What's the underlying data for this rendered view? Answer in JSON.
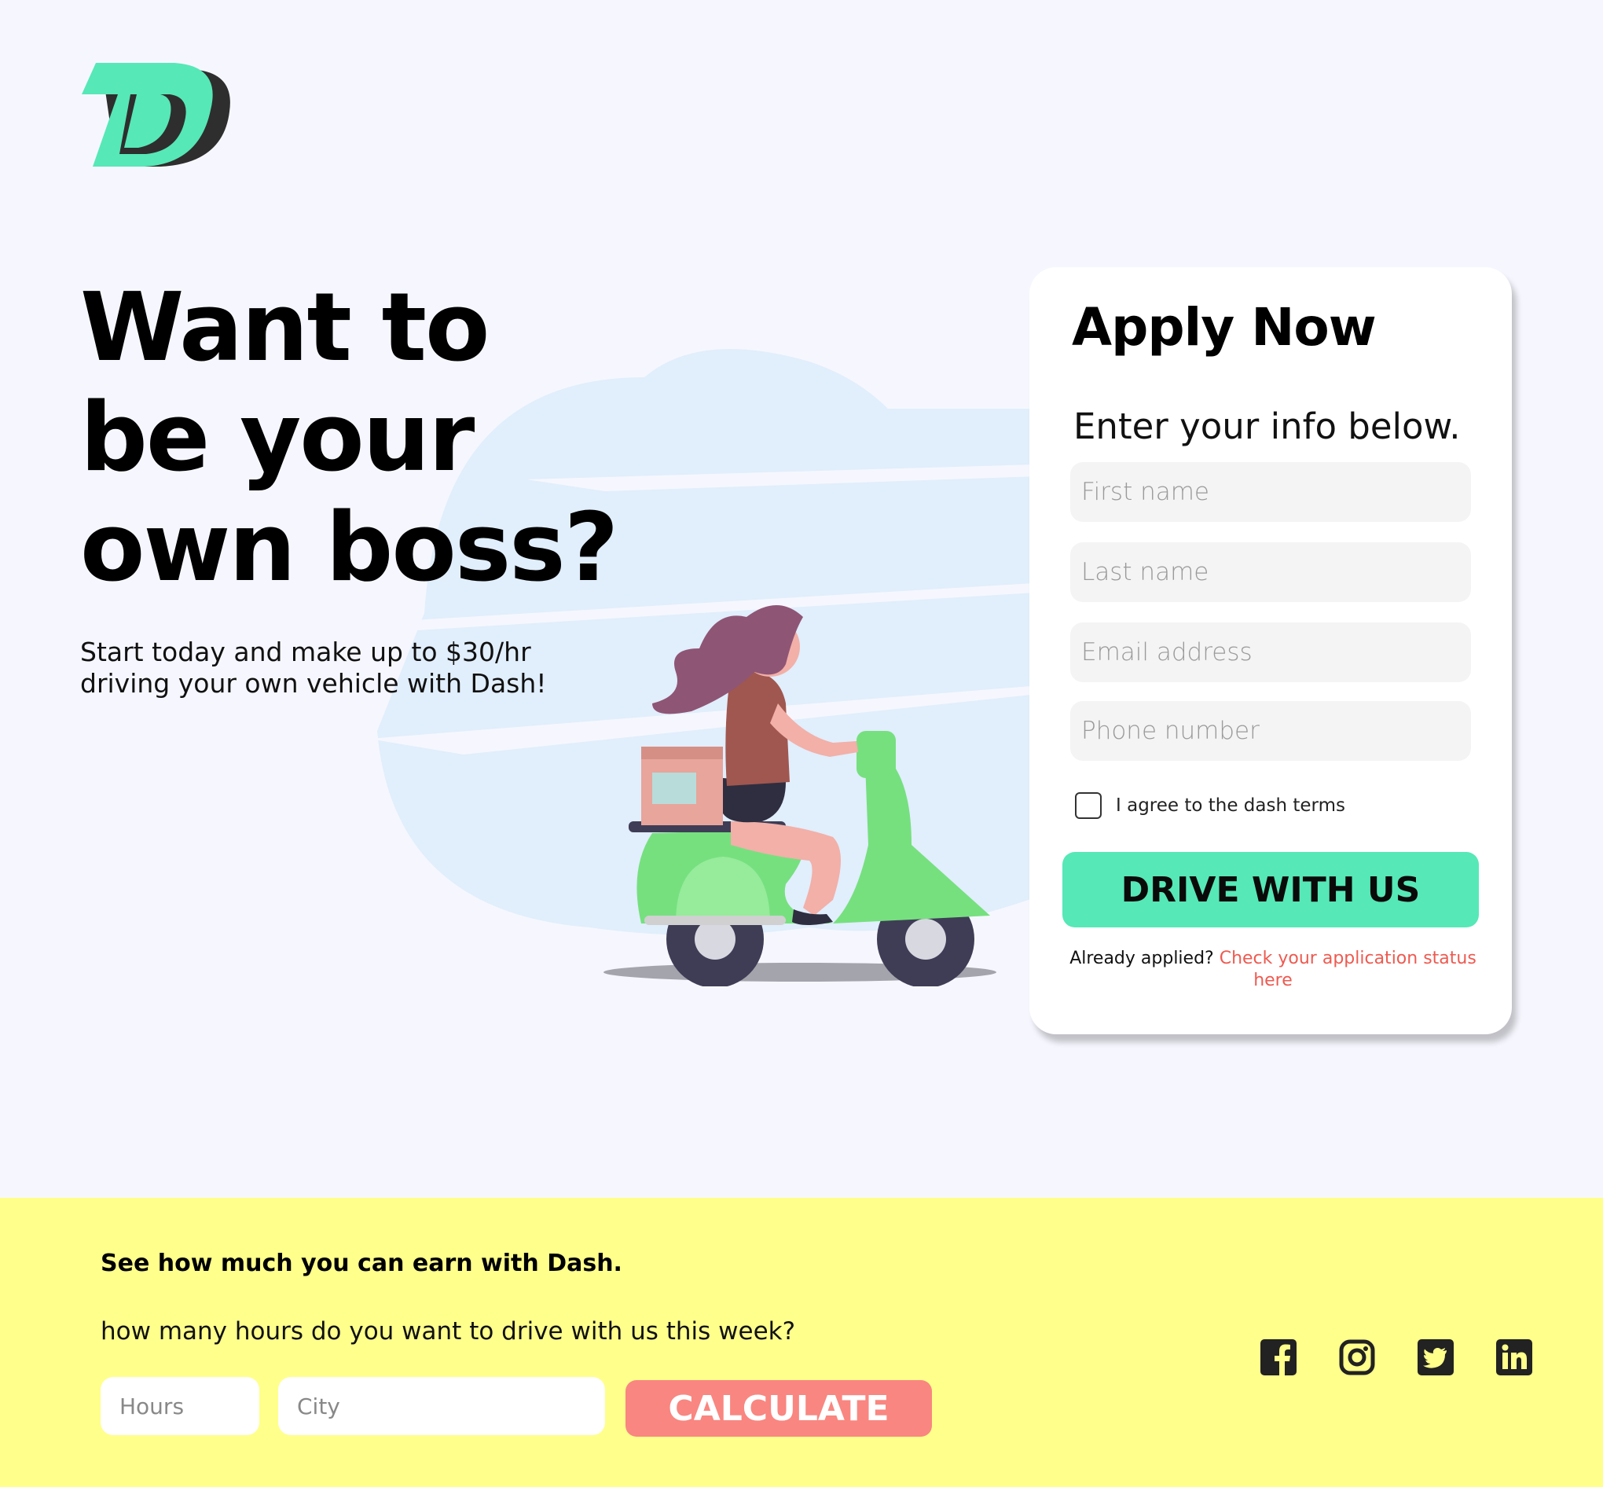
{
  "brand": {
    "logo_icon": "dash-d-logo",
    "accent": "#56e8b7",
    "dark": "#2b2b2b"
  },
  "hero": {
    "title_lines": [
      "Want to",
      "be your",
      "own boss?"
    ],
    "subtitle": "Start today and make up to $30/hr driving your own vehicle with Dash!",
    "illustration": "woman-riding-scooter-illustration"
  },
  "apply": {
    "title": "Apply Now",
    "subtitle": "Enter your info below.",
    "first_name_placeholder": "First name",
    "last_name_placeholder": "Last name",
    "email_placeholder": "Email address",
    "phone_placeholder": "Phone number",
    "terms_label": "I agree to the dash terms",
    "terms_checked": false,
    "submit_label": "DRIVE WITH US",
    "already_applied": "Already applied?",
    "status_link": "Check your application status here",
    "button_color": "#56e8b7",
    "link_color": "#ee5a50"
  },
  "earnings": {
    "title": "See how much you can earn with Dash.",
    "question": "how many hours do you want to drive with us this week?",
    "hours_placeholder": "Hours",
    "city_placeholder": "City",
    "calculate_label": "CALCULATE",
    "background": "#ffff8c",
    "button_color": "#f98680"
  },
  "social": [
    {
      "name": "facebook-icon"
    },
    {
      "name": "instagram-icon"
    },
    {
      "name": "twitter-icon"
    },
    {
      "name": "linkedin-icon"
    }
  ]
}
